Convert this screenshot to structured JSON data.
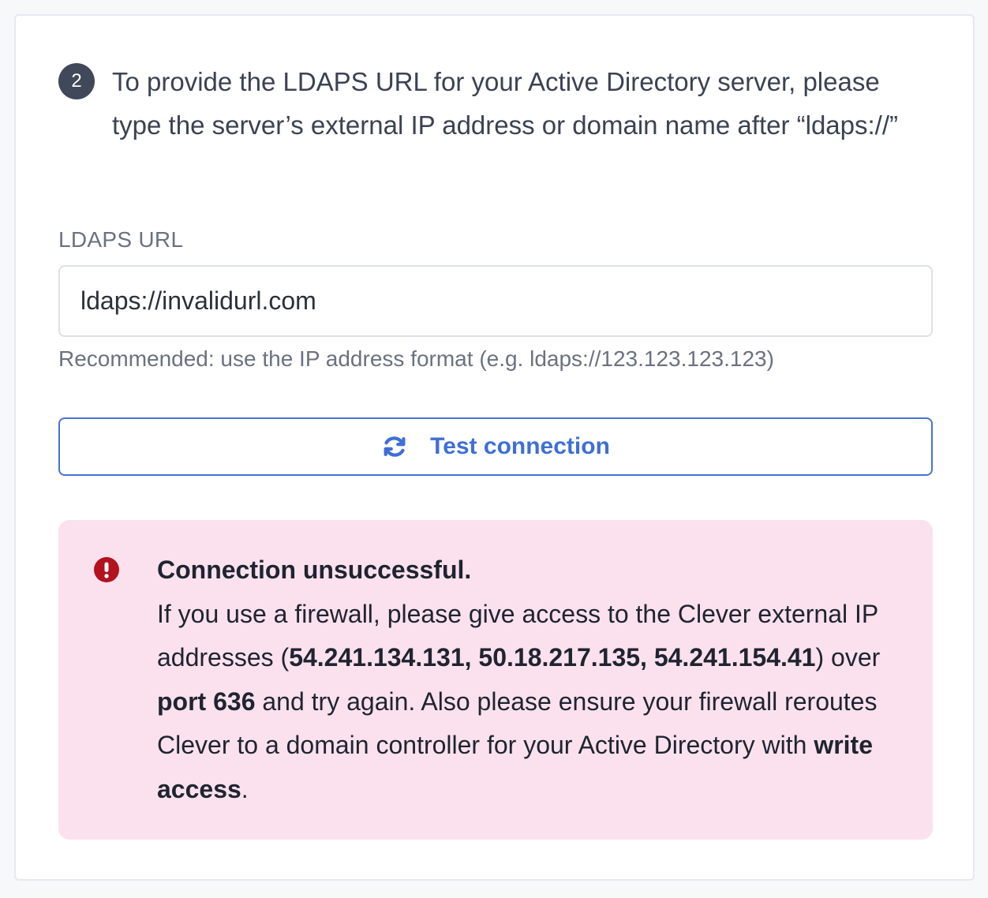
{
  "step": {
    "number": "2",
    "instruction": "To provide the LDAPS URL for your Active Directory server, please type the server’s external IP address or domain name after “ldaps://”"
  },
  "ldaps_field": {
    "label": "LDAPS URL",
    "value": "ldaps://invalidurl.com",
    "helper": "Recommended: use the IP address format (e.g. ldaps://123.123.123.123)"
  },
  "test_button": {
    "label": "Test connection",
    "icon": "refresh-icon",
    "color": "#3f6fd6"
  },
  "error": {
    "title": "Connection unsuccessful.",
    "icon": "exclamation-circle-icon",
    "icon_color": "#b3121f",
    "background": "#fbe1ee",
    "message": {
      "part1": "If you use a firewall, please give access to the Clever external IP addresses (",
      "ips": "54.241.134.131, 50.18.217.135, 54.241.154.41",
      "part2": ") over ",
      "port": "port 636",
      "part3": " and try again. Also please ensure your firewall reroutes Clever to a domain controller for your Active Directory with ",
      "access": "write access",
      "part4": "."
    }
  }
}
